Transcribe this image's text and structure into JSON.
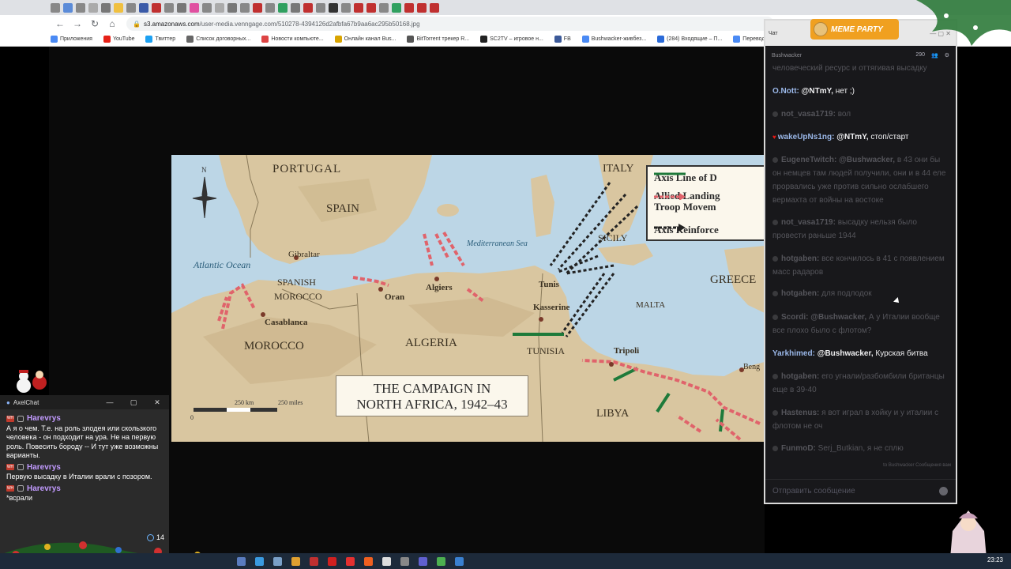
{
  "browser": {
    "url_host": "s3.amazonaws.com",
    "url_path": "/user-media.venngage.com/510278-4394126d2afbfa67b9aa6ac295b50168.jpg",
    "bookmarks": [
      "Приложения",
      "YouTube",
      "Твиттер",
      "Список договорных...",
      "Новости компьюте...",
      "Онлайн канал Bus...",
      "BitTorrent трекер R...",
      "SC2TV – игровое н...",
      "FB",
      "Bushwacker-живбез...",
      "(284) Входящие – П...",
      "Перевод"
    ]
  },
  "map": {
    "title_line1": "THE CAMPAIGN IN",
    "title_line2": "NORTH AFRICA, 1942–43",
    "legend": {
      "axis_line": "Axis Line of D",
      "allied_line1": "Allied Landing",
      "allied_line2": "Troop Movem",
      "axis_reinf": "Axis Reinforce"
    },
    "countries": {
      "portugal": "PORTUGAL",
      "spain": "SPAIN",
      "italy": "ITALY",
      "sicily": "SICILY",
      "spanish_morocco_1": "SPANISH",
      "spanish_morocco_2": "MOROCCO",
      "morocco": "MOROCCO",
      "algeria": "ALGERIA",
      "tunisia": "TUNISIA",
      "libya": "LIBYA",
      "greece": "GREECE",
      "malta": "MALTA"
    },
    "cities": {
      "gibraltar": "Gibraltar",
      "casablanca": "Casablanca",
      "oran": "Oran",
      "algiers": "Algiers",
      "tunis": "Tunis",
      "kasserine": "Kasserine",
      "tripoli": "Tripoli",
      "benghazi": "Beng"
    },
    "seas": {
      "atlantic": "Atlantic Ocean",
      "mediterranean": "Mediterranean Sea"
    },
    "scale": {
      "km": "250 km",
      "miles": "250 miles",
      "zero": "0"
    },
    "colors": {
      "axis_line": "#1e7a3a",
      "allied_arrow": "#e0636b",
      "axis_reinf": "#222222"
    }
  },
  "twitch_chat": {
    "window_title": "Чат",
    "channel": "Bushwacker",
    "viewer_count": "290",
    "logo_text": "MEME PARTY",
    "input_placeholder": "Отправить сообщение",
    "footer_links": "to Bushwacker    Сообщения вам",
    "messages": [
      {
        "nick": "",
        "text": "человеческий ресурс и оттягивая высадку",
        "dim": true,
        "nick_color": "#8d8d93"
      },
      {
        "nick": "O.Nott:",
        "mention": "@NTmY,",
        "text": "нет ;)",
        "dim": false,
        "nick_color": "#9ab7e8"
      },
      {
        "nick": "not_vasa1719:",
        "text": "вол",
        "dim": true,
        "nick_color": "#55555b"
      },
      {
        "nick": "wakeUpNs1ng:",
        "mention": "@NTmY,",
        "text": "стоп/старт",
        "dim": false,
        "nick_color": "#9ab7e8"
      },
      {
        "nick": "EugeneTwitch:",
        "mention": "@Bushwacker,",
        "text": "в 43 они бы он немцев там людей получили, они и в 44 еле прорвались уже против сильно ослабшего вермахта от войны на востоке",
        "dim": true,
        "nick_color": "#55555b"
      },
      {
        "nick": "not_vasa1719:",
        "text": "высадку нельзя было провести раньше 1944",
        "dim": true,
        "nick_color": "#55555b"
      },
      {
        "nick": "hotgaben:",
        "text": "все кончилось в 41 с появлением масс радаров",
        "dim": true,
        "nick_color": "#55555b"
      },
      {
        "nick": "hotgaben:",
        "text": "для подлодок",
        "dim": true,
        "nick_color": "#55555b"
      },
      {
        "nick": "Scordi:",
        "mention": "@Bushwacker,",
        "text": "А у Италии вообще все плохо было с флотом?",
        "dim": true,
        "nick_color": "#55555b"
      },
      {
        "nick": "Yarkhimed:",
        "mention": "@Bushwacker,",
        "text": "Курская битва",
        "dim": false,
        "nick_color": "#9ab7e8"
      },
      {
        "nick": "hotgaben:",
        "text": "его угнали/разбомбили британцы еще в 39-40",
        "dim": true,
        "nick_color": "#55555b"
      },
      {
        "nick": "Hastenus:",
        "text": "я вот играл в хойку и у италии с флотом не оч",
        "dim": true,
        "nick_color": "#55555b"
      },
      {
        "nick": "FunmoD:",
        "text": "Serj_Butkian, я не сплю",
        "dim": true,
        "nick_color": "#55555b"
      }
    ]
  },
  "axelchat": {
    "title": "AxelChat",
    "viewers": "14",
    "messages": [
      {
        "author": "",
        "text": "А я о чем. Т.е. на роль злодея или скользкого человека - он подходит на ура. Не на первую роль.  Повесить бороду -- И тут уже возможны варианты."
      },
      {
        "author": "Harevrys",
        "text": "Первую высадку в Италии врали с позором."
      },
      {
        "author": "Harevrys",
        "text": "*всрали"
      }
    ],
    "first_author": "Harevrys"
  },
  "taskbar": {
    "clock": "23:23"
  }
}
